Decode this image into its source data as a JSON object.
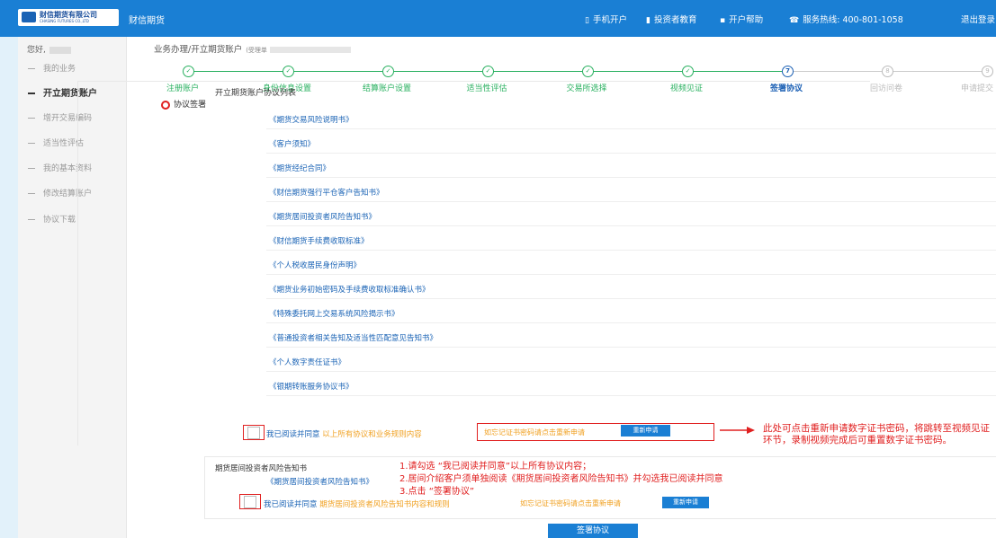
{
  "header": {
    "logo_text": "财信期货有限公司",
    "logo_sub": "CHASING FUTURES CO.,LTD",
    "app_title": "财信期货",
    "nav": [
      {
        "icon": "phone-icon",
        "glyph": "▯",
        "label": "手机开户"
      },
      {
        "icon": "investor-icon",
        "glyph": "▮",
        "label": "投资者教育"
      },
      {
        "icon": "help-icon",
        "glyph": "▪",
        "label": "开户帮助"
      },
      {
        "icon": "telephone-icon",
        "glyph": "☎",
        "label": "服务热线: 400-801-1058"
      },
      {
        "icon": "",
        "glyph": "",
        "label": "退出登录"
      }
    ]
  },
  "sidebar": {
    "greeting": "您好,",
    "items": [
      {
        "label": "我的业务",
        "active": false
      },
      {
        "label": "开立期货账户",
        "active": true
      },
      {
        "label": "增开交易编码",
        "active": false
      },
      {
        "label": "适当性评估",
        "active": false
      },
      {
        "label": "我的基本资料",
        "active": false
      },
      {
        "label": "修改结算账户",
        "active": false
      },
      {
        "label": "协议下载",
        "active": false
      }
    ]
  },
  "breadcrumb": {
    "path": "业务办理/开立期货账户",
    "tail": "(受理单"
  },
  "steps": [
    {
      "num": "✓",
      "label": "注册账户",
      "status": "done"
    },
    {
      "num": "✓",
      "label": "身份信息设置",
      "status": "done"
    },
    {
      "num": "✓",
      "label": "结算账户设置",
      "status": "done"
    },
    {
      "num": "✓",
      "label": "适当性评估",
      "status": "done"
    },
    {
      "num": "✓",
      "label": "交易所选择",
      "status": "done"
    },
    {
      "num": "✓",
      "label": "视频见证",
      "status": "done"
    },
    {
      "num": "7",
      "label": "签署协议",
      "status": "current"
    },
    {
      "num": "8",
      "label": "回访问卷",
      "status": "todo"
    },
    {
      "num": "9",
      "label": "申请提交",
      "status": "todo"
    }
  ],
  "section_title": "协议签署",
  "agreement_list_title": "开立期货账户协议列表",
  "documents": [
    "《期货交易风险说明书》",
    "《客户须知》",
    "《期货经纪合同》",
    "《财信期货强行平仓客户告知书》",
    "《期货居间投资者风险告知书》",
    "《财信期货手续费收取标准》",
    "《个人税收居民身份声明》",
    "《期货业务初始密码及手续费收取标准确认书》",
    "《特殊委托网上交易系统风险揭示书》",
    "《普通投资者相关告知及适当性匹配意见告知书》",
    "《个人数字责任证书》",
    "《银期转账服务协议书》"
  ],
  "agree1": {
    "prefix": "我已阅读并同意",
    "suffix": "以上所有协议和业务规则内容"
  },
  "cert_note": "如忘记证书密码请点击重新申请",
  "reapply_label": "重新申请",
  "annotation_right": "此处可点击重新申请数字证书密码，将跳转至视频见证环节，录制视频完成后可重置数字证书密码。",
  "broker_section_title": "期货居间投资者风险告知书",
  "broker_doc": "《期货居间投资者风险告知书》",
  "agree2": {
    "prefix": "我已阅读并同意",
    "suffix": "期货居间投资者风险告知书内容和规则"
  },
  "instructions": [
    "1.请勾选 “我已阅读并同意”以上所有协议内容；",
    "2.居间介绍客户须单独阅读《期货居间投资者风险告知书》并勾选我已阅读并同意",
    "3.点击 “签署协议”"
  ],
  "sign_button": "签署协议",
  "colors": {
    "primary": "#1a7fd4",
    "success": "#28b05f",
    "warning": "#f0a020",
    "annotation": "#e02020"
  }
}
